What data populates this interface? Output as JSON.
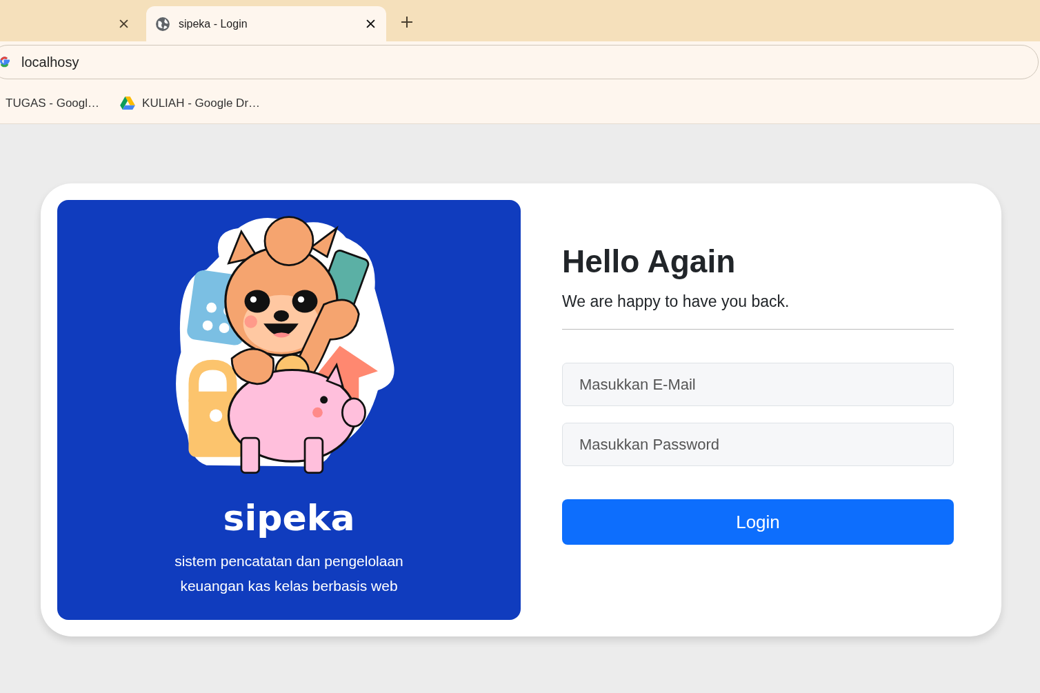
{
  "browser": {
    "tabs": [
      {
        "selected": false
      },
      {
        "title": "sipeka - Login",
        "selected": true
      }
    ],
    "address_bar": {
      "value": "localhosy"
    },
    "bookmarks": [
      {
        "label": "TUGAS - Googl…",
        "kind": "plain"
      },
      {
        "label": "KULIAH - Google Dr…",
        "kind": "drive"
      }
    ]
  },
  "brand_panel": {
    "name": "sipeka",
    "tagline": "sistem pencatatan dan pengelolaan\nkeuangan kas kelas berbasis web"
  },
  "login_form": {
    "heading": "Hello Again",
    "subheading": "We are happy to have you back.",
    "fields": [
      {
        "placeholder": "Masukkan E-Mail"
      },
      {
        "placeholder": "Masukkan Password"
      }
    ],
    "submit": "Login"
  }
}
